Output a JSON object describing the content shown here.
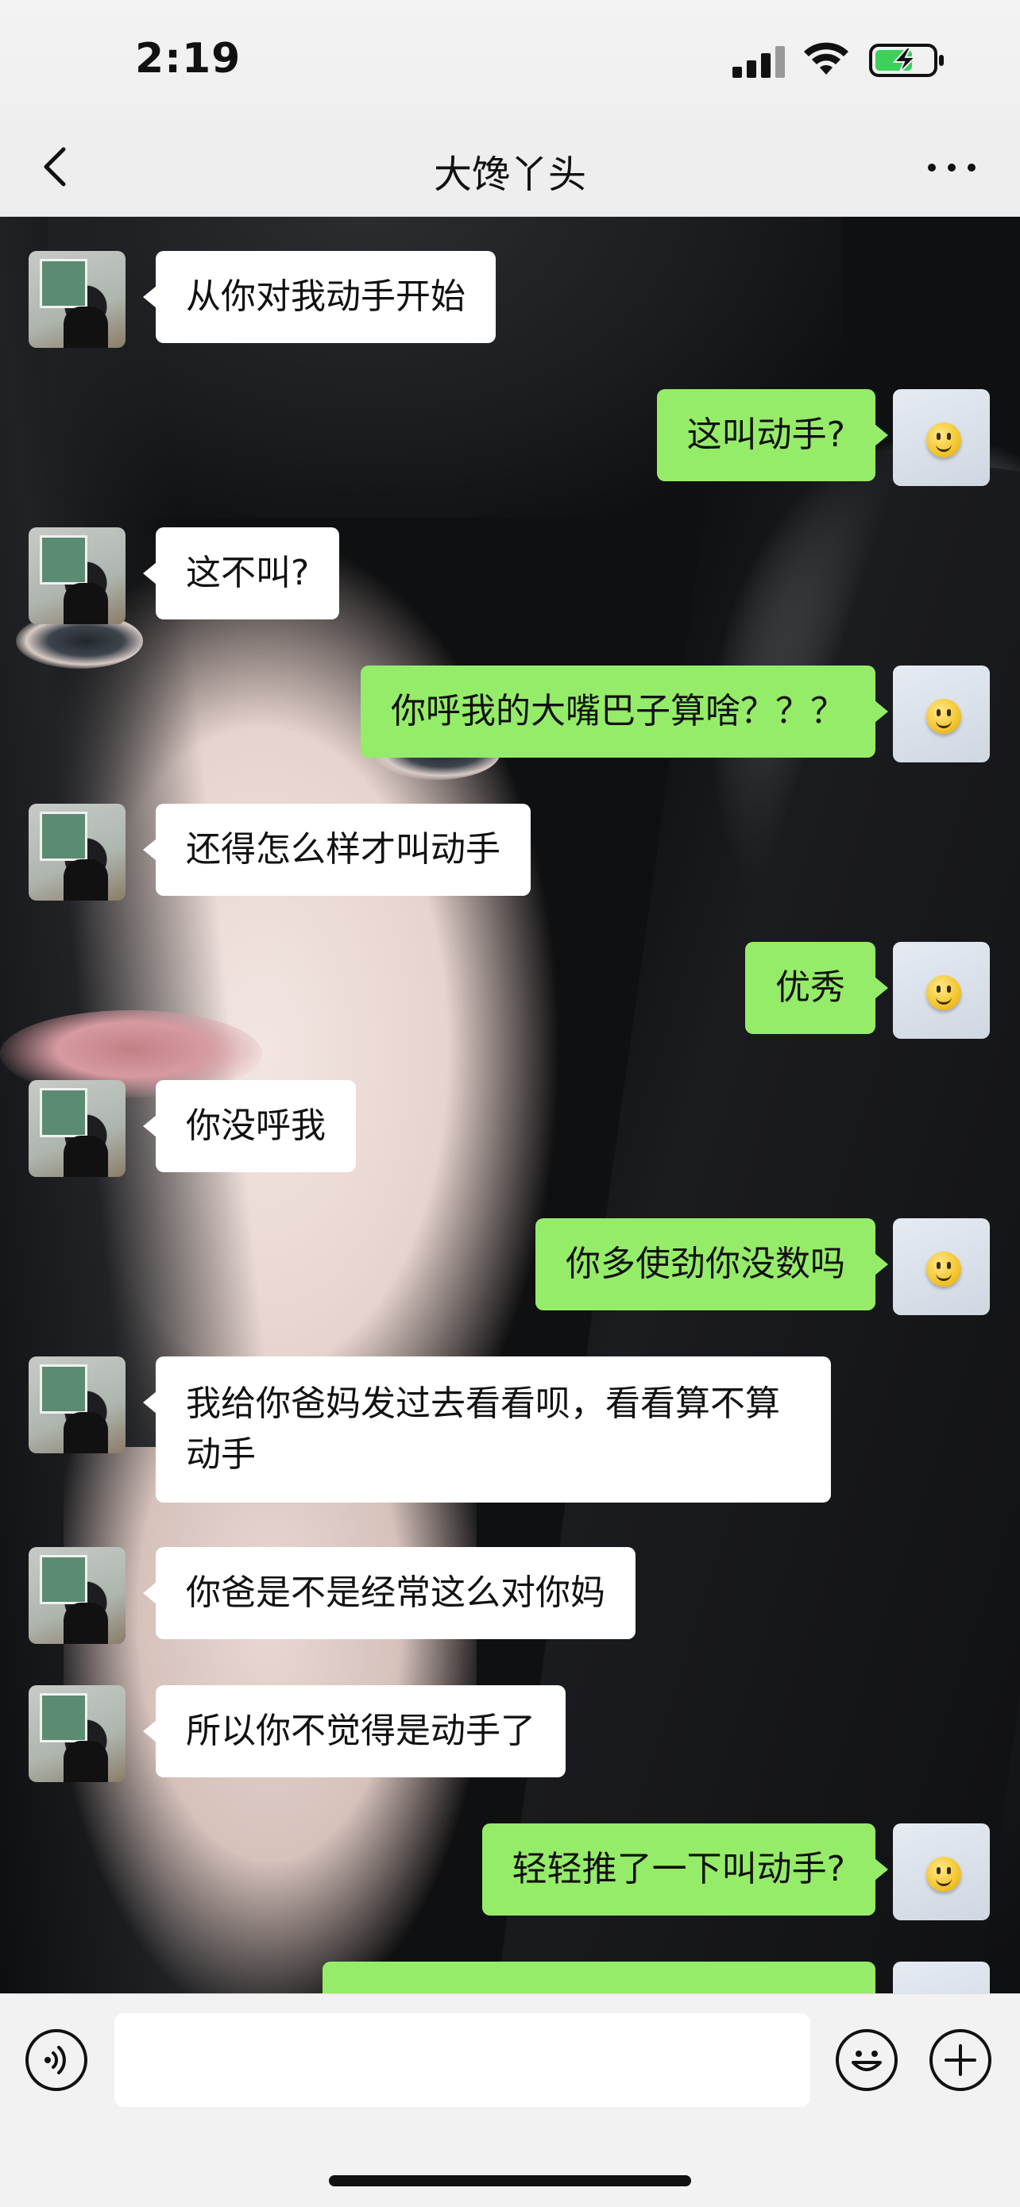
{
  "status_bar": {
    "time": "2:19"
  },
  "nav": {
    "title": "大馋丫头",
    "back_icon": "chevron-left-icon",
    "more_icon": "more-dots-icon"
  },
  "messages": [
    {
      "from": "them",
      "text": "从你对我动手开始"
    },
    {
      "from": "me",
      "text": "这叫动手?"
    },
    {
      "from": "them",
      "text": "这不叫?"
    },
    {
      "from": "me",
      "text": "你呼我的大嘴巴子算啥？？？"
    },
    {
      "from": "them",
      "text": "还得怎么样才叫动手"
    },
    {
      "from": "me",
      "text": "优秀"
    },
    {
      "from": "them",
      "text": "你没呼我"
    },
    {
      "from": "me",
      "text": "你多使劲你没数吗"
    },
    {
      "from": "them",
      "text": "我给你爸妈发过去看看呗，看看算不算动手"
    },
    {
      "from": "them",
      "text": "你爸是不是经常这么对你妈"
    },
    {
      "from": "them",
      "text": "所以你不觉得是动手了"
    },
    {
      "from": "me",
      "text": "轻轻推了一下叫动手?"
    },
    {
      "from": "me",
      "text": ""
    }
  ],
  "input_bar": {
    "voice_icon": "voice-icon",
    "emoji_icon": "emoji-icon",
    "plus_icon": "plus-icon",
    "text": ""
  },
  "colors": {
    "my_bubble": "#95ec69",
    "their_bubble": "#ffffff",
    "nav_bg": "#eeeeee"
  }
}
